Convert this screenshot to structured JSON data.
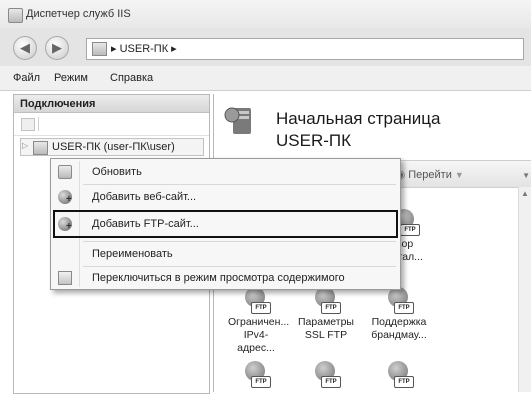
{
  "window": {
    "title": "Диспетчер служб IIS",
    "icon": "iis-app-icon"
  },
  "navigation": {
    "back_icon": "back-arrow-icon",
    "forward_icon": "forward-arrow-icon",
    "address": "▸  USER-ПК  ▸"
  },
  "menu": {
    "items": [
      {
        "label": "Файл"
      },
      {
        "label": "Режим"
      },
      {
        "label": "Справка"
      }
    ]
  },
  "connections": {
    "header": "Подключения",
    "tree": [
      {
        "label": "USER-ПК (user-ПК\\user)",
        "icon": "server-icon"
      }
    ]
  },
  "home": {
    "title": "Начальная страница\nUSER-ПК",
    "goto_label": "Перейти",
    "goto_icon": "binoculars-icon",
    "features": [
      {
        "label": "зор\nкатал...",
        "icon": "ftp-browse-icon"
      },
      {
        "label": "Ограничен...\nIPv4-адрес...",
        "icon": "ftp-ipv4-icon"
      },
      {
        "label": "Параметры\nSSL FTP",
        "icon": "ftp-ssl-icon"
      },
      {
        "label": "Поддержка\nбрандмау...",
        "icon": "ftp-firewall-icon"
      },
      {
        "label": "",
        "icon": "ftp-authentication-icon"
      },
      {
        "label": "",
        "icon": "ftp-authorization-icon"
      },
      {
        "label": "",
        "icon": "ftp-logging-icon"
      }
    ]
  },
  "context_menu": {
    "items": [
      {
        "label": "Обновить",
        "icon": "refresh-icon"
      },
      {
        "label": "Добавить веб-сайт...",
        "icon": "add-website-icon"
      },
      {
        "label": "Добавить FTP-сайт...",
        "icon": "add-ftp-site-icon",
        "highlighted": true
      },
      {
        "label": "Переименовать",
        "icon": ""
      },
      {
        "label": "Переключиться в режим просмотра содержимого",
        "icon": "content-view-icon"
      }
    ]
  }
}
